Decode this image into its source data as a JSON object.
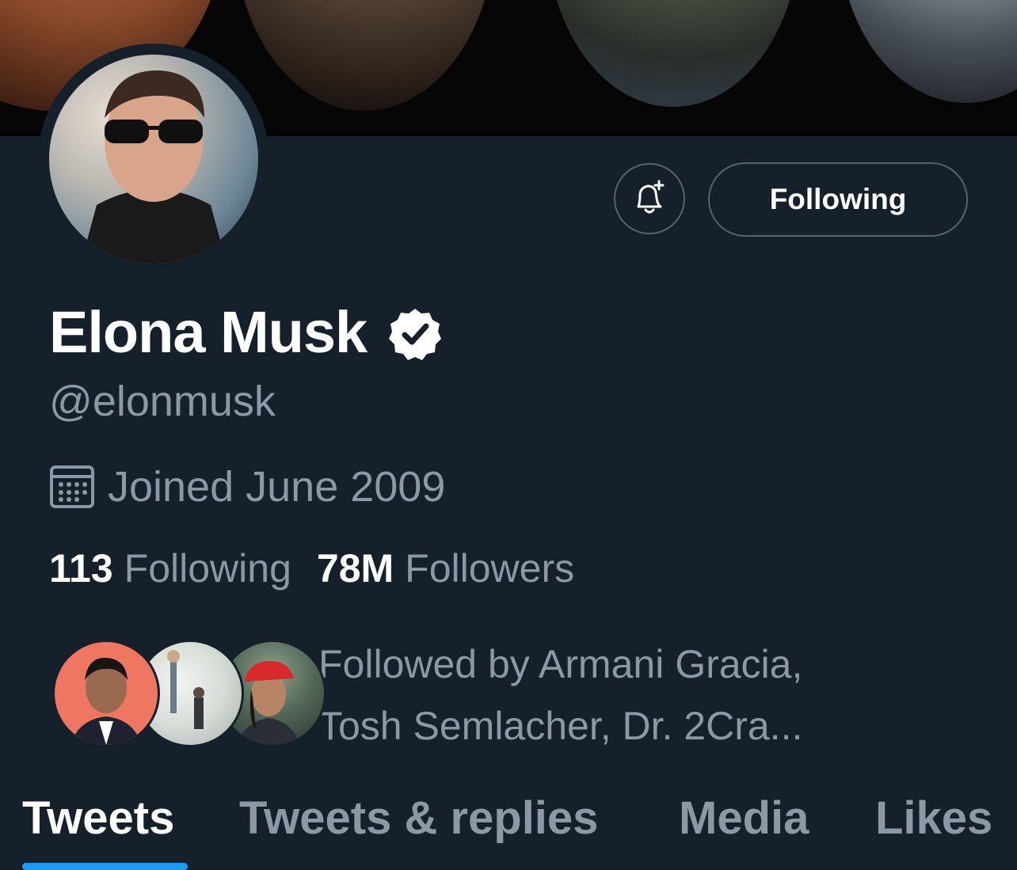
{
  "profile": {
    "display_name": "Elona Musk",
    "handle": "@elonmusk",
    "joined": "Joined June 2009",
    "following_count": "113",
    "following_label": "Following",
    "followers_count": "78M",
    "followers_label": "Followers",
    "followed_by_line1": "Followed by Armani Gracia,",
    "followed_by_line2": "Tosh Semlacher, Dr. 2Cra..."
  },
  "actions": {
    "following_button": "Following",
    "notify_icon": "bell-plus-icon"
  },
  "tabs": [
    {
      "label": "Tweets",
      "active": true
    },
    {
      "label": "Tweets & replies",
      "active": false
    },
    {
      "label": "Media",
      "active": false
    },
    {
      "label": "Likes",
      "active": false
    }
  ],
  "colors": {
    "background": "#15202b",
    "muted_text": "#8b98a5",
    "accent": "#1d9bf0",
    "border": "#536471"
  }
}
